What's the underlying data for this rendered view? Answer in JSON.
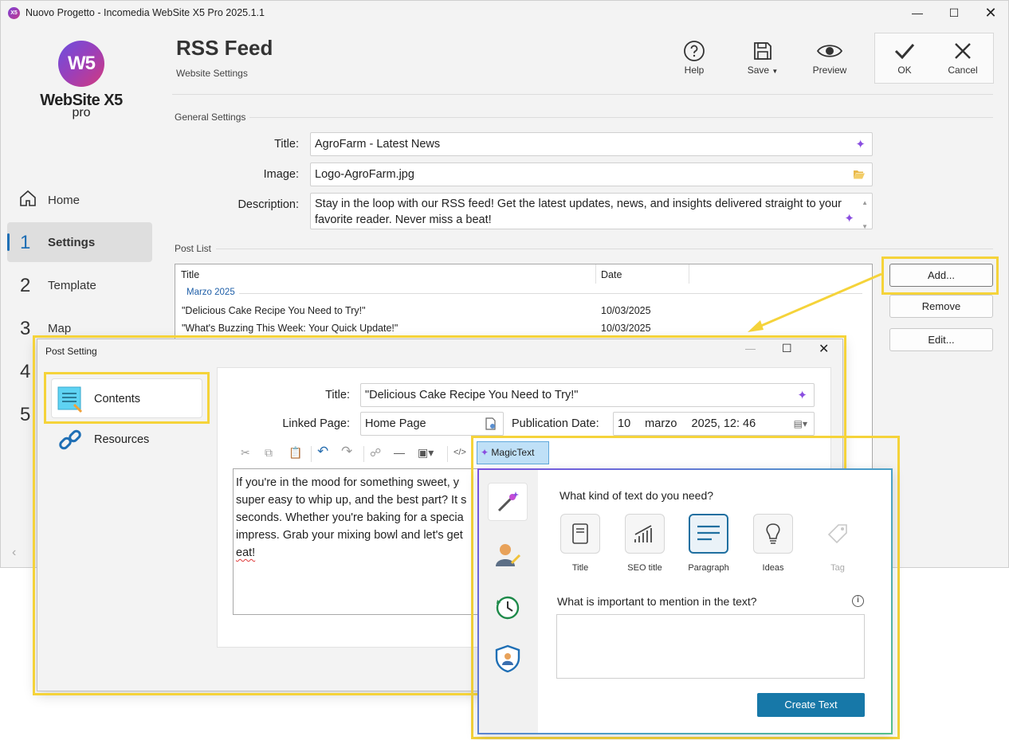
{
  "window": {
    "title": "Nuovo Progetto - Incomedia WebSite X5 Pro 2025.1.1",
    "app_icon_text": "X5"
  },
  "logo": {
    "mark": "W5",
    "name": "WebSite X5",
    "edition": "pro"
  },
  "sidebar": {
    "items": [
      {
        "num": "",
        "label": "Home"
      },
      {
        "num": "1",
        "label": "Settings"
      },
      {
        "num": "2",
        "label": "Template"
      },
      {
        "num": "3",
        "label": "Map"
      },
      {
        "num": "4",
        "label": ""
      },
      {
        "num": "5",
        "label": ""
      }
    ]
  },
  "header": {
    "title": "RSS Feed",
    "subtitle": "Website Settings",
    "help_label": "Help",
    "save_label": "Save",
    "preview_label": "Preview",
    "ok_label": "OK",
    "cancel_label": "Cancel"
  },
  "general": {
    "section_label": "General Settings",
    "title_label": "Title:",
    "title_value": "AgroFarm - Latest News",
    "image_label": "Image:",
    "image_value": "Logo-AgroFarm.jpg",
    "description_label": "Description:",
    "description_value": "Stay in the loop with our RSS feed! Get the latest updates, news, and insights delivered straight to your favorite reader. Never miss a beat!"
  },
  "post_list": {
    "section_label": "Post List",
    "col_title": "Title",
    "col_date": "Date",
    "group": "Marzo 2025",
    "rows": [
      {
        "title": "\"Delicious Cake Recipe You Need to Try!\"",
        "date": "10/03/2025"
      },
      {
        "title": "\"What's Buzzing This Week: Your Quick Update!\"",
        "date": "10/03/2025"
      }
    ],
    "add_label": "Add...",
    "remove_label": "Remove",
    "edit_label": "Edit..."
  },
  "post_dialog": {
    "title": "Post Setting",
    "tabs": [
      {
        "label": "Contents"
      },
      {
        "label": "Resources"
      }
    ],
    "title_label": "Title:",
    "title_value": "\"Delicious Cake Recipe You Need to Try!\"",
    "linked_page_label": "Linked Page:",
    "linked_page_value": "Home Page",
    "publication_date_label": "Publication Date:",
    "date_day": "10",
    "date_month": "marzo",
    "date_rest": "2025, 12: 46",
    "magic_text_label": "MagicText",
    "editor_lines": [
      "If you're in the mood for something sweet, y",
      "super easy to whip up, and the best part? It s",
      "seconds. Whether you're baking for a specia",
      "impress. Grab your mixing bowl and let's get",
      "eat!"
    ]
  },
  "magic_panel": {
    "question_kind": "What kind of text do you need?",
    "kinds": [
      {
        "label": "Title",
        "icon": "document-icon"
      },
      {
        "label": "SEO title",
        "icon": "chart-bars-icon"
      },
      {
        "label": "Paragraph",
        "icon": "paragraph-lines-icon"
      },
      {
        "label": "Ideas",
        "icon": "lightbulb-icon"
      },
      {
        "label": "Tag",
        "icon": "tag-icon"
      }
    ],
    "selected_kind": "Paragraph",
    "question_mention": "What is important to mention in the text?",
    "mention_value": "",
    "create_label": "Create Text"
  },
  "colors": {
    "accent": "#1f6fb5",
    "highlight": "#f5d33a",
    "primary_button": "#1778a8"
  }
}
